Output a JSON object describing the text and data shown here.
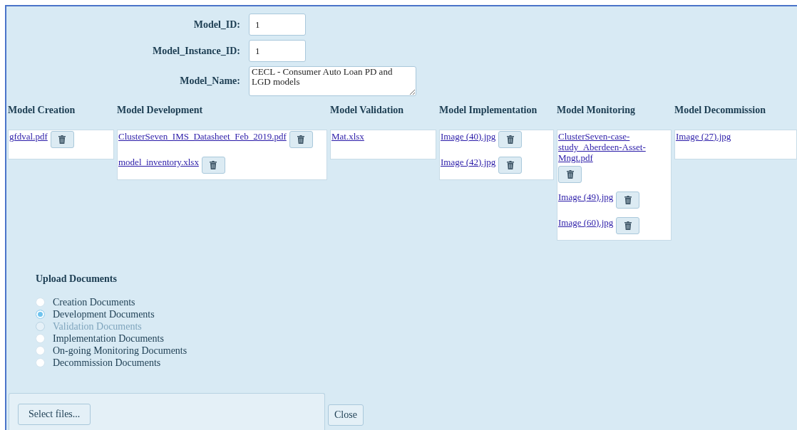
{
  "fields": [
    {
      "label": "Model_ID:",
      "value": "1",
      "kind": "input"
    },
    {
      "label": "Model_Instance_ID:",
      "value": "1",
      "kind": "input"
    },
    {
      "label": "Model_Name:",
      "value": "CECL - Consumer Auto Loan PD and LGD models",
      "kind": "textarea"
    }
  ],
  "stages": [
    {
      "title": "Model Creation",
      "files": [
        "gfdval.pdf"
      ]
    },
    {
      "title": "Model Development",
      "files": [
        "ClusterSeven_IMS_Datasheet_Feb_2019.pdf",
        "model_inventory.xlsx"
      ]
    },
    {
      "title": "Model Validation",
      "files": [
        "Mat.xlsx"
      ],
      "no_delete": true
    },
    {
      "title": "Model Implementation",
      "files": [
        "Image (40).jpg",
        "Image (42).jpg"
      ]
    },
    {
      "title": "Model Monitoring",
      "files": [
        "ClusterSeven-case-study_Aberdeen-Asset-Mngt.pdf",
        "Image (49).jpg",
        "Image (60).jpg"
      ]
    },
    {
      "title": "Model Decommission",
      "files": [
        "Image (27).jpg"
      ],
      "no_delete": true
    }
  ],
  "upload": {
    "heading": "Upload Documents",
    "options": [
      {
        "label": "Creation Documents",
        "selected": false,
        "disabled": false
      },
      {
        "label": "Development Documents",
        "selected": true,
        "disabled": false
      },
      {
        "label": "Validation Documents",
        "selected": false,
        "disabled": true
      },
      {
        "label": "Implementation Documents",
        "selected": false,
        "disabled": false
      },
      {
        "label": "On-going Monitoring Documents",
        "selected": false,
        "disabled": false
      },
      {
        "label": "Decommission Documents",
        "selected": false,
        "disabled": false
      }
    ],
    "select_button": "Select files...",
    "close_button": "Close"
  }
}
